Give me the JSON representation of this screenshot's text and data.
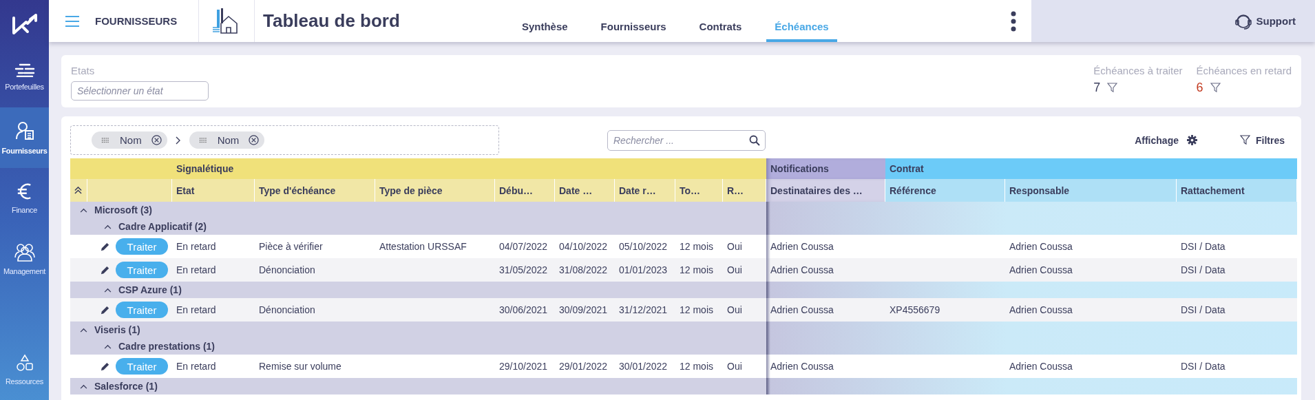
{
  "sidebar": {
    "items": [
      {
        "label": "Portefeuilles",
        "kind": "portfolio",
        "selected": false
      },
      {
        "label": "Fournisseurs",
        "kind": "supplier",
        "selected": true
      },
      {
        "label": "Finance",
        "kind": "finance",
        "selected": false
      },
      {
        "label": "Management",
        "kind": "team",
        "selected": false
      },
      {
        "label": "Ressources",
        "kind": "resources",
        "selected": false
      }
    ]
  },
  "header": {
    "module": "FOURNISSEURS",
    "title": "Tableau de bord",
    "support": "Support",
    "tabs": [
      {
        "label": "Synthèse",
        "selected": false
      },
      {
        "label": "Fournisseurs",
        "selected": false
      },
      {
        "label": "Contrats",
        "selected": false
      },
      {
        "label": "Échéances",
        "selected": true
      }
    ]
  },
  "filters": {
    "label": "Etats",
    "placeholder": "Sélectionner un état",
    "counters": [
      {
        "label": "Échéances à traiter",
        "value": "7",
        "kind": "normal"
      },
      {
        "label": "Échéances en retard",
        "value": "6",
        "kind": "alert"
      }
    ]
  },
  "grouping": {
    "chips": [
      "Nom",
      "Nom"
    ]
  },
  "search": {
    "placeholder": "Rechercher ..."
  },
  "toolbar": {
    "display": "Affichage",
    "filters": "Filtres"
  },
  "table": {
    "column_groups": [
      {
        "label": "Signalétique",
        "kind": "signaletique",
        "columns": [
          "Etat",
          "Type d'échéance",
          "Type de pièce",
          "Débu…",
          "Date …",
          "Date r…",
          "To…",
          "R…"
        ]
      },
      {
        "label": "Notifications",
        "kind": "notifications",
        "columns": [
          "Destinataires des …"
        ]
      },
      {
        "label": "Contrat",
        "kind": "contrat",
        "columns": [
          "Référence",
          "Responsable",
          "Rattachement"
        ]
      }
    ],
    "groups": [
      {
        "label": "Microsoft (3)",
        "expanded": true,
        "children": [
          {
            "label": "Cadre Applicatif (2)",
            "expanded": true,
            "rows": [
              {
                "action": "Traiter",
                "cells": [
                  "En retard",
                  "Pièce à vérifier",
                  "Attestation URSSAF",
                  "04/07/2022",
                  "04/10/2022",
                  "05/10/2022",
                  "12 mois",
                  "Oui",
                  "Adrien Coussa",
                  null,
                  "Adrien Coussa",
                  "DSI / Data"
                ]
              },
              {
                "action": "Traiter",
                "cells": [
                  "En retard",
                  "Dénonciation",
                  null,
                  "31/05/2022",
                  "31/08/2022",
                  "01/01/2023",
                  "12 mois",
                  "Oui",
                  "Adrien Coussa",
                  null,
                  "Adrien Coussa",
                  "DSI / Data"
                ]
              }
            ]
          },
          {
            "label": "CSP Azure (1)",
            "expanded": true,
            "rows": [
              {
                "action": "Traiter",
                "cells": [
                  "En retard",
                  "Dénonciation",
                  null,
                  "30/06/2021",
                  "30/09/2021",
                  "31/12/2021",
                  "12 mois",
                  "Oui",
                  "Adrien Coussa",
                  "XP4556679",
                  "Adrien Coussa",
                  "DSI / Data"
                ]
              }
            ]
          }
        ]
      },
      {
        "label": "Viseris (1)",
        "expanded": true,
        "children": [
          {
            "label": "Cadre prestations (1)",
            "expanded": true,
            "rows": [
              {
                "action": "Traiter",
                "cells": [
                  "En retard",
                  "Remise sur volume",
                  null,
                  "29/10/2021",
                  "29/01/2022",
                  "30/01/2022",
                  "12 mois",
                  "Oui",
                  "Adrien Coussa",
                  null,
                  "Adrien Coussa",
                  "DSI / Data"
                ]
              }
            ]
          }
        ]
      },
      {
        "label": "Salesforce (1)",
        "expanded": true
      }
    ]
  }
}
